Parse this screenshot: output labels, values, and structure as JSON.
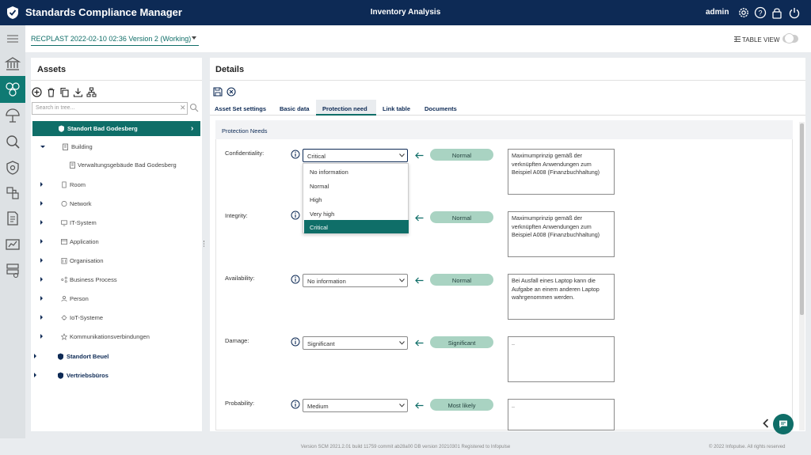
{
  "app": {
    "title": "Standards Compliance Manager",
    "center_title": "Inventory Analysis",
    "user": "admin"
  },
  "subheader": {
    "version": "RECPLAST 2022-02-10 02:36 Version 2 (Working)",
    "table_view_label": "TABLE VIEW"
  },
  "assets": {
    "title": "Assets",
    "search_placeholder": "Search in tree...",
    "tree": [
      {
        "label": "Standort Bad Godesberg",
        "kind": "location",
        "selected": true
      },
      {
        "label": "Building",
        "kind": "group"
      },
      {
        "label": "Verwaltungsgebäude Bad Godesberg",
        "kind": "leaf"
      },
      {
        "label": "Room",
        "kind": "group"
      },
      {
        "label": "Network",
        "kind": "group"
      },
      {
        "label": "IT-System",
        "kind": "group"
      },
      {
        "label": "Application",
        "kind": "group"
      },
      {
        "label": "Organisation",
        "kind": "group"
      },
      {
        "label": "Business Process",
        "kind": "group"
      },
      {
        "label": "Person",
        "kind": "group"
      },
      {
        "label": "IoT-Systeme",
        "kind": "group"
      },
      {
        "label": "Kommunikationsverbindungen",
        "kind": "group"
      },
      {
        "label": "Standort Beuel",
        "kind": "location"
      },
      {
        "label": "Vertriebsbüros",
        "kind": "location"
      }
    ]
  },
  "details": {
    "title": "Details",
    "tabs": [
      "Asset Set settings",
      "Basic data",
      "Protection need",
      "Link table",
      "Documents"
    ],
    "active_tab": "Protection need",
    "section_title": "Protection Needs",
    "fields": [
      {
        "label": "Confidentiality:",
        "value": "Critical",
        "suggested": "Normal",
        "note": "Maximumprinzip gemäß der verknüpften Anwendungen zum Beispiel A008 (Finanzbuchhaltung)"
      },
      {
        "label": "Integrity:",
        "value": "",
        "suggested": "Normal",
        "note": "Maximumprinzip gemäß der verknüpften Anwendungen zum Beispiel A008 (Finanzbuchhaltung)"
      },
      {
        "label": "Availability:",
        "value": "No information",
        "suggested": "Normal",
        "note": "Bei Ausfall eines Laptop kann die Aufgabe an einem anderen Laptop wahrgenommen werden."
      },
      {
        "label": "Damage:",
        "value": "Significant",
        "suggested": "Significant",
        "note": ".."
      },
      {
        "label": "Probability:",
        "value": "Medium",
        "suggested": "Most likely",
        "note": ".."
      }
    ],
    "dropdown_options": [
      "No information",
      "Normal",
      "High",
      "Very high",
      "Critical"
    ],
    "dropdown_selected": "Critical"
  },
  "footer": {
    "version": "Version SCM 2021.2.01 build 11759 commit ab28a00   DB version 20210301   Registered to Infopulse",
    "copyright": "© 2022 Infopulse. All rights reserved"
  },
  "colors": {
    "navy": "#0d2a55",
    "teal": "#0f6e68",
    "suggest_green": "#a9d3c2"
  }
}
